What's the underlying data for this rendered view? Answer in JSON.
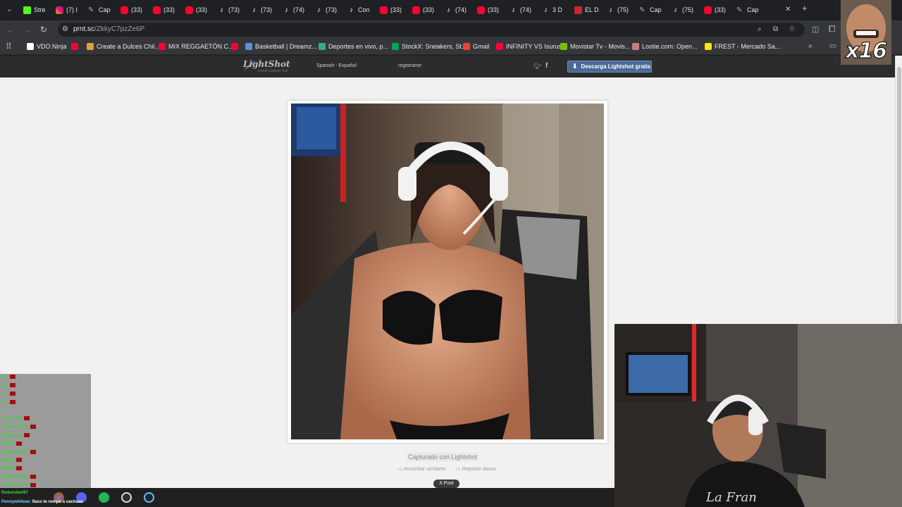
{
  "browser": {
    "tabs": [
      {
        "label": "Stre",
        "icon": "kick-icon"
      },
      {
        "label": "(7) I",
        "icon": "instagram-icon"
      },
      {
        "label": "Cap",
        "icon": "lightshot-icon"
      },
      {
        "label": "(33)",
        "icon": "youtube-icon"
      },
      {
        "label": "(33)",
        "icon": "youtube-icon"
      },
      {
        "label": "(33)",
        "icon": "youtube-icon"
      },
      {
        "label": "(73)",
        "icon": "tiktok-icon"
      },
      {
        "label": "(73)",
        "icon": "tiktok-icon"
      },
      {
        "label": "(74)",
        "icon": "tiktok-icon"
      },
      {
        "label": "(73)",
        "icon": "tiktok-icon"
      },
      {
        "label": "Con",
        "icon": "tiktok-icon"
      },
      {
        "label": "(33)",
        "icon": "youtube-icon"
      },
      {
        "label": "(33)",
        "icon": "youtube-icon"
      },
      {
        "label": "(74)",
        "icon": "tiktok-icon"
      },
      {
        "label": "(33)",
        "icon": "youtube-icon"
      },
      {
        "label": "(74)",
        "icon": "tiktok-icon"
      },
      {
        "label": "3 D",
        "icon": "tiktok-icon"
      },
      {
        "label": "EL D",
        "icon": "eldiario-icon"
      },
      {
        "label": "(75)",
        "icon": "tiktok-icon"
      },
      {
        "label": "Cap",
        "icon": "lightshot-icon"
      },
      {
        "label": "(75)",
        "icon": "tiktok-icon"
      },
      {
        "label": "(33)",
        "icon": "youtube-icon"
      },
      {
        "label": "Cap",
        "icon": "lightshot-icon"
      }
    ],
    "url_host": "prnt.sc",
    "url_path": "/ZkkyC7pzZe6P",
    "bookmarks": [
      {
        "label": "VDO.Ninja",
        "color": "#ffffff"
      },
      {
        "label": "",
        "color": "#ff0033"
      },
      {
        "label": "Create a Dulces Chil...",
        "color": "#e0a040"
      },
      {
        "label": "MIX REGGAETÓN C...",
        "color": "#ff0033"
      },
      {
        "label": "",
        "color": "#ff0033"
      },
      {
        "label": "Basketball | Dreamz...",
        "color": "#5a8fd8"
      },
      {
        "label": "Deportes en vivo, p...",
        "color": "#2db08a"
      },
      {
        "label": "StockX: Sneakers, St...",
        "color": "#08a05c"
      },
      {
        "label": "Gmail",
        "color": "#ea4335"
      },
      {
        "label": "INFINITY VS Isurus",
        "color": "#ff0033"
      },
      {
        "label": "Movistar Tv - Movis...",
        "color": "#79c000"
      },
      {
        "label": "Lootie.com: Open...",
        "color": "#c08080"
      },
      {
        "label": "FREST - Mercado Sa...",
        "color": "#ffe600"
      }
    ]
  },
  "lightshot": {
    "logo": "LightShot",
    "logo_sub": "screen capture tool",
    "language": "Spanish - Español",
    "register": "registrarse",
    "download": "Descarga Lightshot gratis",
    "caption": "Capturado con Lightshot",
    "find_similar": "encontrar similares",
    "report": "Reportar abuso",
    "post": "X Post"
  },
  "chat": {
    "lines": [
      {
        "name": "R...",
        "badge": true
      },
      {
        "name": "R...",
        "badge": true
      },
      {
        "name": "R...",
        "badge": true
      },
      {
        "name": "R...",
        "badge": true
      },
      {
        "name": "r...",
        "badge": false
      },
      {
        "name": "FelipeTalk",
        "badge": true
      },
      {
        "name": "Redundant97",
        "badge": true
      },
      {
        "name": "FelipeTalk",
        "badge": true
      },
      {
        "name": "I4BEN",
        "badge": true
      },
      {
        "name": "Redundant97",
        "badge": true
      },
      {
        "name": "I4BEN",
        "badge": true
      },
      {
        "name": "I4BEN",
        "badge": true
      },
      {
        "name": "Redundant97",
        "badge": true
      },
      {
        "name": "Redundant97",
        "badge": true
      }
    ],
    "last_name": "Redundant97",
    "last_user": "Pennywhiteee:",
    "last_msg": "flaco te rompo a cachaaa"
  },
  "overlay": {
    "emote_text": "x16"
  },
  "colors": {
    "chat_name": "#38d63a",
    "download_button": "#4a6a96",
    "page_bg": "#f1f1f1"
  }
}
